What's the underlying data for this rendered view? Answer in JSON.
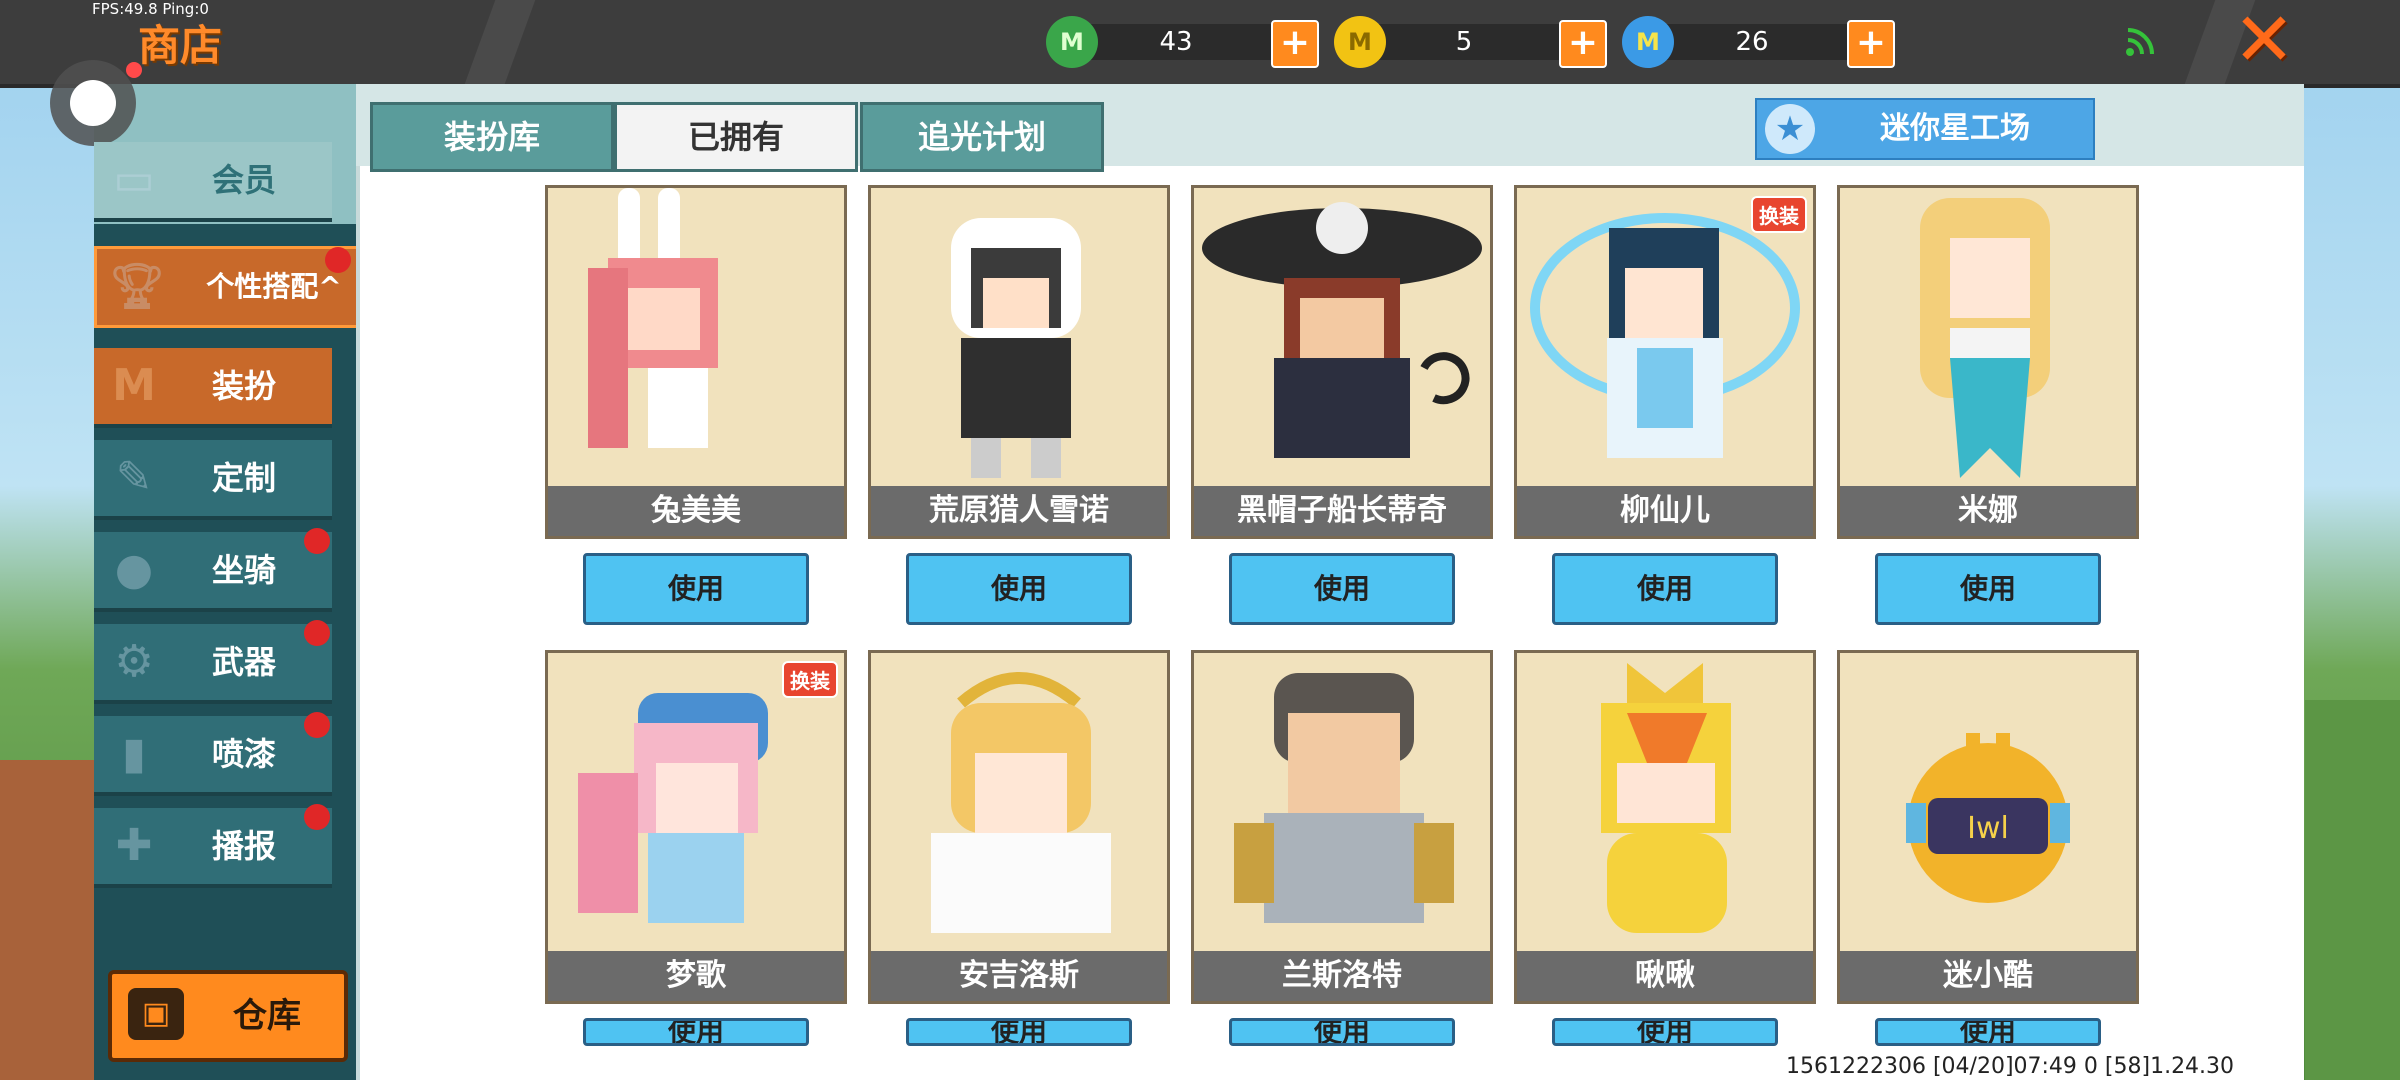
{
  "hud": {
    "fps": "FPS:49.8  Ping:0",
    "title": "商店"
  },
  "currencies": [
    {
      "icon": "green-gem-icon",
      "value": "43",
      "color": "#3aa64a"
    },
    {
      "icon": "gold-coin-icon",
      "value": "5",
      "color": "#f2c313"
    },
    {
      "icon": "blue-mini-coin-icon",
      "value": "26",
      "color": "#3b9ae6"
    }
  ],
  "plus_symbol": "+",
  "close_symbol": "✕",
  "tabs": {
    "wardrobe": "装扮库",
    "owned": "已拥有",
    "chase_light": "追光计划"
  },
  "workshop_button": "迷你星工场",
  "sidebar": {
    "items": [
      {
        "label": "会员",
        "icon": "member-icon"
      },
      {
        "label": "个性搭配^",
        "icon": "trophy-icon"
      },
      {
        "label": "装扮",
        "icon": "shirt-icon"
      },
      {
        "label": "定制",
        "icon": "pencil-icon"
      },
      {
        "label": "坐骑",
        "icon": "footprint-icon"
      },
      {
        "label": "武器",
        "icon": "gun-icon"
      },
      {
        "label": "喷漆",
        "icon": "spray-icon"
      },
      {
        "label": "播报",
        "icon": "broadcast-icon"
      }
    ],
    "warehouse": "仓库"
  },
  "skins": [
    {
      "name": "兔美美",
      "button": "使用"
    },
    {
      "name": "荒原猎人雪诺",
      "button": "使用"
    },
    {
      "name": "黑帽子船长蒂奇",
      "button": "使用"
    },
    {
      "name": "柳仙儿",
      "button": "使用",
      "tag": "换装"
    },
    {
      "name": "米娜",
      "button": "使用"
    },
    {
      "name": "梦歌",
      "button": "使用",
      "tag": "换装"
    },
    {
      "name": "安吉洛斯",
      "button": "使用"
    },
    {
      "name": "兰斯洛特",
      "button": "使用"
    },
    {
      "name": "啾啾",
      "button": "使用"
    },
    {
      "name": "迷小酷",
      "button": "使用"
    }
  ],
  "footer": "1561222306    [04/20]07:49 0 [58]1.24.30"
}
